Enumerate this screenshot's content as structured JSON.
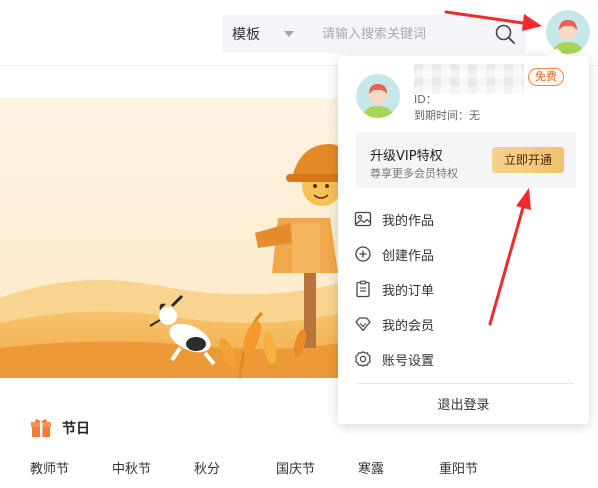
{
  "search": {
    "type_label": "模板",
    "placeholder": "请输入搜索关键词"
  },
  "user_menu": {
    "badge": "免费",
    "id_label": "ID：",
    "expire_label": "到期时间：无",
    "vip_title": "升级VIP特权",
    "vip_subtitle": "尊享更多会员特权",
    "vip_button": "立即开通",
    "items": [
      {
        "label": "我的作品",
        "icon": "image-icon"
      },
      {
        "label": "创建作品",
        "icon": "plus-circle-icon"
      },
      {
        "label": "我的订单",
        "icon": "clipboard-icon"
      },
      {
        "label": "我的会员",
        "icon": "diamond-icon"
      },
      {
        "label": "账号设置",
        "icon": "gear-icon"
      }
    ],
    "logout": "退出登录"
  },
  "festival": {
    "title": "节日",
    "row1": [
      "教师节",
      "中秋节",
      "秋分",
      "国庆节",
      "寒露",
      "重阳节"
    ]
  },
  "colors": {
    "accent_orange": "#f06a1a",
    "arrow_red": "#ee2a2a",
    "vip_button": "#f0c270",
    "gift_icon": "#f07b3c"
  }
}
